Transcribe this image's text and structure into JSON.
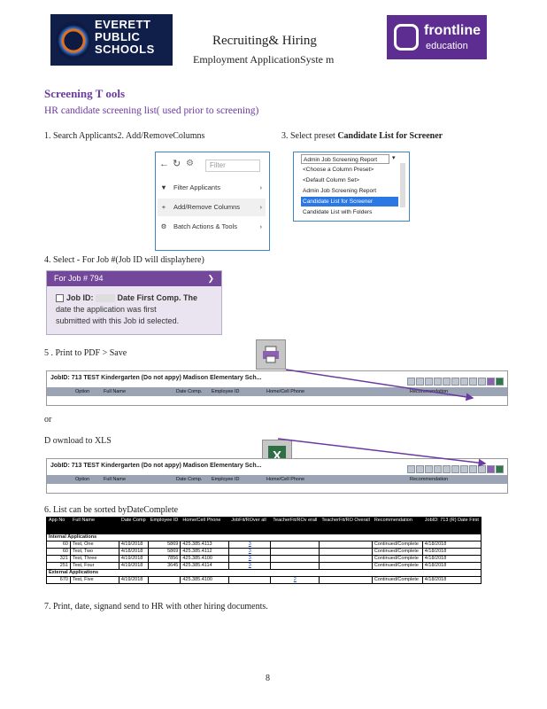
{
  "header": {
    "district_logo": "EVERETT PUBLIC SCHOOLS",
    "vendor_logo_word": "frontline",
    "vendor_logo_sub": "education",
    "title": "Recruiting& Hiring",
    "subtitle": "Employment ApplicationSyste m"
  },
  "section": {
    "title": "Screening T ools",
    "subtitle": "HR candidate screening list( used prior to screening)"
  },
  "steps": {
    "s1": "1. Search Applicants2. Add/RemoveColumns",
    "s3_prefix": "3. Select preset",
    "s3_bold": "Candidate List for Screener",
    "s4": "4. Select - For Job #(Job ID will displayhere)",
    "s5": "5 . Print to PDF > Save",
    "or": "or",
    "download": "D ownload to XLS",
    "s6": "6. List can be sorted byDateComplete",
    "s7": "7. Print, date, signand send to HR with other hiring documents."
  },
  "menu1": {
    "filter_placeholder": "Filter",
    "items": [
      {
        "label": "Filter Applicants",
        "icon": "filter-icon"
      },
      {
        "label": "Add/Remove Columns",
        "icon": "plus-icon"
      },
      {
        "label": "Batch Actions & Tools",
        "icon": "gear-icon"
      }
    ]
  },
  "dropdown": {
    "selected": "Admin Job Screening Report",
    "options": [
      "<Choose a Column Preset>",
      "<Default Column Set>",
      "Admin Job Screening Report",
      "Candidate List for Screener",
      "Candidate List with Folders"
    ],
    "highlighted": "Candidate List for Screener"
  },
  "jobbox": {
    "header": "For Job # 794",
    "label": "Job ID:",
    "text1": "Date First Comp. The",
    "text2": "date the application was first",
    "text3": "submitted with this Job id selected."
  },
  "jobbar": {
    "title": "JobID: 713 TEST Kindergarten (Do not appy) Madison Elementary Sch...",
    "columns": [
      "Option",
      "Full Name",
      "Date Comp.",
      "Employee ID",
      "Home/Cell Phone",
      "Recommendation"
    ]
  },
  "table": {
    "headers": [
      "App No",
      "Full Name",
      "Date Comp",
      "Employee ID",
      "Home/Cell Phone",
      "JobFit/ROver all",
      "TeacherFit/ROv erall",
      "TeacherFit/RO Overall",
      "Recommendation",
      "JobID: 713 (R) Date First"
    ],
    "groups": [
      {
        "name": "Internal Applications",
        "rows": [
          [
            "60",
            "Test, One",
            "4/19/2018",
            "5869",
            "425.385.4113",
            "3",
            "",
            "",
            "Continued/Complete",
            "4/18/2018"
          ],
          [
            "60",
            "Test, Two",
            "4/18/2018",
            "5869",
            "425.385.4112",
            "3",
            "",
            "",
            "Continued/Complete",
            "4/18/2018"
          ],
          [
            "321",
            "Test, Three",
            "4/19/2018",
            "7856",
            "425.385.4100",
            "3",
            "",
            "",
            "Continued/Complete",
            "4/18/2018"
          ],
          [
            "251",
            "Test, Four",
            "4/19/2018",
            "3645",
            "425.385.4114",
            "3",
            "",
            "",
            "Continued/Complete",
            "4/18/2018"
          ]
        ]
      },
      {
        "name": "External Applications",
        "rows": [
          [
            "670",
            "Test, Five",
            "4/19/2018",
            "",
            "425.385.4100",
            "",
            "2",
            "",
            "Continued/Complete",
            "4/18/2018"
          ]
        ]
      }
    ]
  },
  "page_number": "8",
  "colors": {
    "section": "#6b3aa0",
    "vendor": "#5e2d91",
    "district": "#101e4a",
    "highlight": "#2b78e4"
  }
}
